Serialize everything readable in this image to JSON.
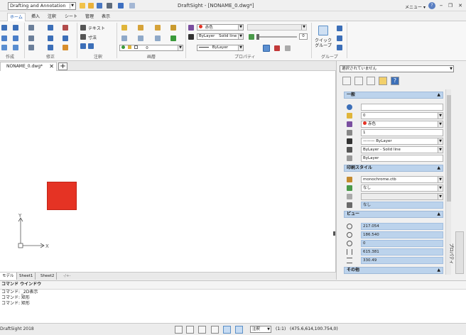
{
  "titlebar": {
    "workspace": "Drafting and Annotation",
    "title": "DraftSight - [NONAME_0.dwg*]",
    "menu_label": "メニュー",
    "menu_arrow": "▾",
    "help_icon": "?",
    "minimize": "–",
    "restore": "❐",
    "close": "✕"
  },
  "ribbon_tabs": [
    "ホーム",
    "挿入",
    "注釈",
    "シート",
    "管理",
    "表示"
  ],
  "ribbon": {
    "text_tool": "テキスト",
    "dim_tool": "寸法",
    "layer_value": "0",
    "color_value": "赤色",
    "linetype_value": "ByLayer",
    "lineweight_value": "ByLayer",
    "linestyle_value": "Solid line",
    "transparency_value": "0",
    "quick_group": "クイック\nグループ",
    "groups": [
      "作成",
      "修正",
      "注釈",
      "画層",
      "プロパティ",
      "グループ"
    ]
  },
  "document": {
    "tab_name": "NONAME_0.dwg*",
    "close_glyph": "✕",
    "new_tab_glyph": "+"
  },
  "layout_tabs": [
    "モデル",
    "Sheet1",
    "Sheet2",
    "-/+-"
  ],
  "command_window": {
    "title": "コマンド ウインドウ",
    "lines": [
      "コマンド: _2D表示",
      "コマンド: 矩形",
      "コマンド: 矩形"
    ]
  },
  "statusbar": {
    "app_version": "DraftSight 2018",
    "annotation": "注釈",
    "scale": "(1:1)",
    "coords": "(475.6,614,100.754,0)"
  },
  "properties": {
    "selection": "選択されていません",
    "palette_tab": "プロパティ",
    "sections": {
      "general": "一般",
      "print_style": "印刷スタイル",
      "view": "ビュー",
      "other": "その他"
    },
    "general_rows": [
      "",
      "0",
      "赤色",
      "1",
      "——— ByLayer",
      "ByLayer  -  Solid line",
      "ByLayer"
    ],
    "print_rows": [
      "monochrome.ctb",
      "なし",
      "",
      "なし"
    ],
    "view_rows": [
      "217.054",
      "186.540",
      "0",
      "615.381",
      "330.49"
    ]
  },
  "colors": {
    "accent": "#1a5bb5",
    "red_object": "#e53324",
    "section_header": "#bcd3ec"
  }
}
